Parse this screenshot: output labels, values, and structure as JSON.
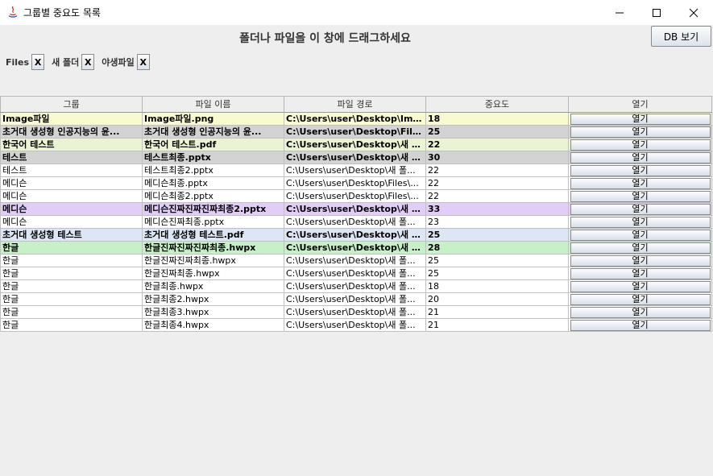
{
  "window": {
    "title": "그룹별 중요도 목록"
  },
  "drop_message": "폴더나 파일을 이 창에 드래그하세요",
  "db_button_label": "DB 보기",
  "tags": [
    {
      "label": "Files",
      "close": "X"
    },
    {
      "label": "새 폴더",
      "close": "X"
    },
    {
      "label": "야생파일",
      "close": "X"
    }
  ],
  "table": {
    "headers": [
      "그룹",
      "파일 이름",
      "파일 경로",
      "중요도",
      "열기"
    ],
    "open_label": "열기",
    "rows": [
      {
        "group": "Image파일",
        "name": "Image파일.png",
        "path": "C:\\Users\\user\\Desktop\\Imag...",
        "importance": "18",
        "bg": "#fafad2",
        "bold": true
      },
      {
        "group": "초거대 생성형 인공지능의 윤...",
        "name": "초거대 생성형 인공지능의 윤...",
        "path": "C:\\Users\\user\\Desktop\\Files\\...",
        "importance": "25",
        "bg": "#d3d3d3",
        "bold": true
      },
      {
        "group": "한국어 테스트",
        "name": "한국어 테스트.pdf",
        "path": "C:\\Users\\user\\Desktop\\새 폴...",
        "importance": "22",
        "bg": "#eaf4d4",
        "bold": true
      },
      {
        "group": "테스트",
        "name": "테스트최종.pptx",
        "path": "C:\\Users\\user\\Desktop\\새 폴...",
        "importance": "30",
        "bg": "#d3d3d3",
        "bold": true
      },
      {
        "group": "테스트",
        "name": "테스트최종2.pptx",
        "path": "C:\\Users\\user\\Desktop\\새 폴...",
        "importance": "22",
        "bg": "#ffffff",
        "bold": false
      },
      {
        "group": "메디슨",
        "name": "메디슨최종.pptx",
        "path": "C:\\Users\\user\\Desktop\\Files\\...",
        "importance": "22",
        "bg": "#ffffff",
        "bold": false
      },
      {
        "group": "메디슨",
        "name": "메디슨최종2.pptx",
        "path": "C:\\Users\\user\\Desktop\\Files\\...",
        "importance": "22",
        "bg": "#ffffff",
        "bold": false
      },
      {
        "group": "메디슨",
        "name": "메디슨진짜진짜진짜최종2.pptx",
        "path": "C:\\Users\\user\\Desktop\\새 폴...",
        "importance": "33",
        "bg": "#e1cdf6",
        "bold": true
      },
      {
        "group": "메디슨",
        "name": "메디슨진짜최종.pptx",
        "path": "C:\\Users\\user\\Desktop\\새 폴...",
        "importance": "23",
        "bg": "#ffffff",
        "bold": false
      },
      {
        "group": "초거대 생성형 테스트",
        "name": "초거대 생성형 테스트.pdf",
        "path": "C:\\Users\\user\\Desktop\\새 폴...",
        "importance": "25",
        "bg": "#dce6f4",
        "bold": true
      },
      {
        "group": "한글",
        "name": "한글진짜진짜진짜최종.hwpx",
        "path": "C:\\Users\\user\\Desktop\\새 폴...",
        "importance": "28",
        "bg": "#c8f0c8",
        "bold": true
      },
      {
        "group": "한글",
        "name": "한글진짜진짜최종.hwpx",
        "path": "C:\\Users\\user\\Desktop\\새 폴...",
        "importance": "25",
        "bg": "#ffffff",
        "bold": false
      },
      {
        "group": "한글",
        "name": "한글진짜최종.hwpx",
        "path": "C:\\Users\\user\\Desktop\\새 폴...",
        "importance": "25",
        "bg": "#ffffff",
        "bold": false
      },
      {
        "group": "한글",
        "name": "한글최종.hwpx",
        "path": "C:\\Users\\user\\Desktop\\새 폴...",
        "importance": "18",
        "bg": "#ffffff",
        "bold": false
      },
      {
        "group": "한글",
        "name": "한글최종2.hwpx",
        "path": "C:\\Users\\user\\Desktop\\새 폴...",
        "importance": "20",
        "bg": "#ffffff",
        "bold": false
      },
      {
        "group": "한글",
        "name": "한글최종3.hwpx",
        "path": "C:\\Users\\user\\Desktop\\새 폴...",
        "importance": "21",
        "bg": "#ffffff",
        "bold": false
      },
      {
        "group": "한글",
        "name": "한글최종4.hwpx",
        "path": "C:\\Users\\user\\Desktop\\새 폴...",
        "importance": "21",
        "bg": "#ffffff",
        "bold": false
      }
    ]
  }
}
